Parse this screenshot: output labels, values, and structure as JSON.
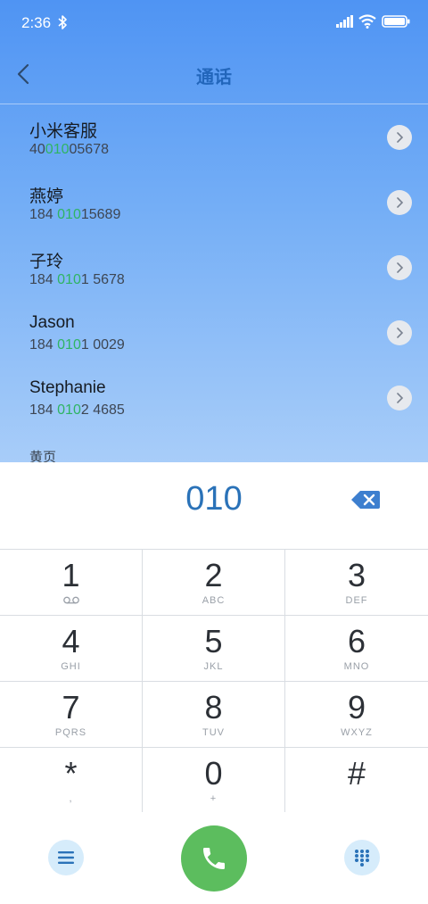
{
  "status_bar": {
    "time": "2:36",
    "icons": [
      "bluetooth-icon",
      "signal-icon",
      "wifi-icon",
      "battery-icon"
    ]
  },
  "header": {
    "title": "通话",
    "back_icon": "back-arrow-icon"
  },
  "contacts": [
    {
      "name": "小米客服",
      "number_before": "40",
      "number_match": "010",
      "number_after": "05678"
    },
    {
      "name": "燕婷",
      "number_before": "184 ",
      "number_match": "010",
      "number_after": "15689"
    },
    {
      "name": "子玲",
      "number_before": "184 ",
      "number_match": "010",
      "number_after": "1 5678"
    },
    {
      "name": "Jason",
      "number_before": "184 ",
      "number_match": "010",
      "number_after": "1 0029"
    },
    {
      "name": "Stephanie",
      "number_before": "184 ",
      "number_match": "010",
      "number_after": "2 4685"
    }
  ],
  "section_label": "黄页",
  "dialer": {
    "input": "010",
    "keys": [
      {
        "digit": "1",
        "letters": "",
        "icon": "voicemail-icon"
      },
      {
        "digit": "2",
        "letters": "ABC"
      },
      {
        "digit": "3",
        "letters": "DEF"
      },
      {
        "digit": "4",
        "letters": "GHI"
      },
      {
        "digit": "5",
        "letters": "JKL"
      },
      {
        "digit": "6",
        "letters": "MNO"
      },
      {
        "digit": "7",
        "letters": "PQRS"
      },
      {
        "digit": "8",
        "letters": "TUV"
      },
      {
        "digit": "9",
        "letters": "WXYZ"
      },
      {
        "digit": "*",
        "letters": ","
      },
      {
        "digit": "0",
        "letters": "+"
      },
      {
        "digit": "#",
        "letters": ""
      }
    ]
  },
  "colors": {
    "accent_blue": "#2a72b8",
    "match_green": "#2fb463",
    "call_green": "#5cbd5e",
    "header_gradient_top": "#4f94f3"
  }
}
